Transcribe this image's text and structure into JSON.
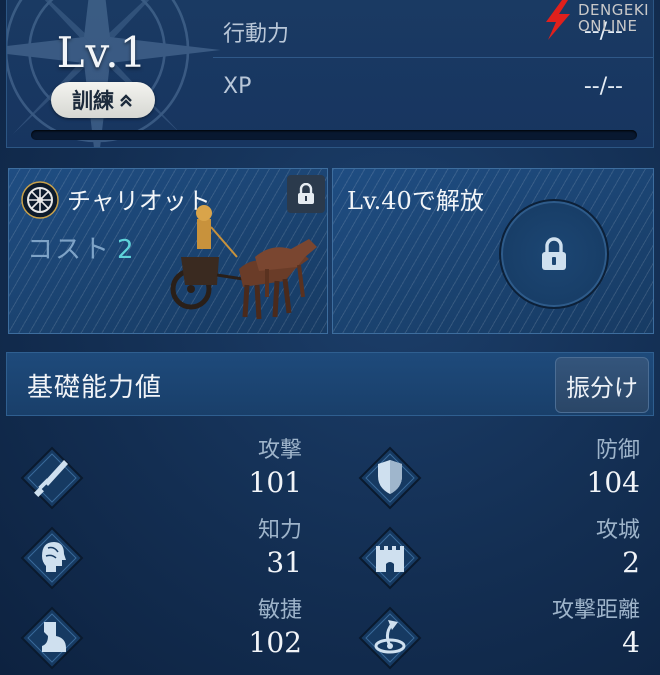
{
  "header": {
    "level": "Lv.1",
    "train_label": "訓練",
    "stats": [
      {
        "label": "行動力",
        "value": "--/--"
      },
      {
        "label": "XP",
        "value": "--/--"
      }
    ],
    "xp_progress": 0
  },
  "watermark": {
    "line1": "DENGEKI",
    "line2": "ONLINE"
  },
  "unit_card": {
    "name": "チャリオット",
    "cost_label": "コスト",
    "cost_value": "2",
    "icon": "chariot-wheel-icon",
    "locked": true
  },
  "locked_card": {
    "unlock_text": "Lv.40で解放",
    "icon": "lock-icon"
  },
  "base_stats": {
    "title": "基礎能力値",
    "assign_label": "振分け",
    "items": [
      {
        "name": "攻撃",
        "value": "101",
        "icon": "sword-icon"
      },
      {
        "name": "防御",
        "value": "104",
        "icon": "shield-icon"
      },
      {
        "name": "知力",
        "value": "31",
        "icon": "head-icon"
      },
      {
        "name": "攻城",
        "value": "2",
        "icon": "castle-icon"
      },
      {
        "name": "敏捷",
        "value": "102",
        "icon": "boot-icon"
      },
      {
        "name": "攻撃距離",
        "value": "4",
        "icon": "range-icon"
      }
    ]
  },
  "colors": {
    "background": "#132e52",
    "panel": "#1a3a63",
    "accent_cost": "#5fd2d9",
    "icon_fill": "#cfe0ef"
  }
}
